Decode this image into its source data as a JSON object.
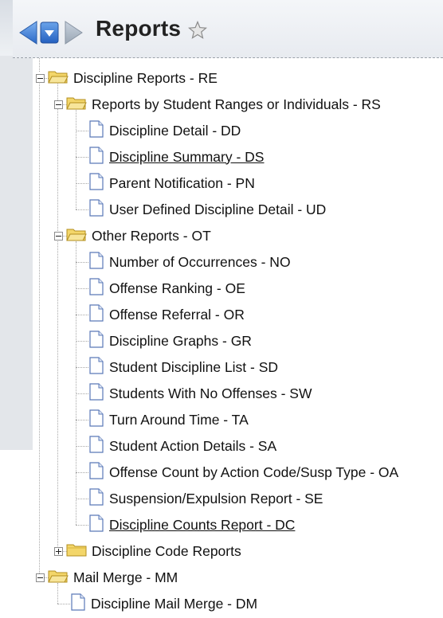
{
  "header": {
    "title": "Reports",
    "icons": [
      "back-arrow-icon",
      "menu-dropdown-icon",
      "forward-arrow-icon",
      "star-icon"
    ]
  },
  "colors": {
    "folder": "#e8c44a",
    "doc_border": "#5a79b8",
    "nav_blue": "#3a7ad6",
    "link": "#111111"
  },
  "tree": [
    {
      "label": "Discipline Reports - RE",
      "type": "folder",
      "expanded": true
    },
    {
      "label": "Reports by Student Ranges or Individuals - RS",
      "type": "folder",
      "expanded": true
    },
    {
      "label": "Discipline Detail - DD",
      "type": "report"
    },
    {
      "label": "Discipline Summary - DS",
      "type": "report",
      "underlined": true
    },
    {
      "label": "Parent Notification - PN",
      "type": "report"
    },
    {
      "label": "User Defined Discipline Detail - UD",
      "type": "report"
    },
    {
      "label": "Other Reports - OT",
      "type": "folder",
      "expanded": true
    },
    {
      "label": "Number of Occurrences - NO",
      "type": "report"
    },
    {
      "label": "Offense Ranking - OE",
      "type": "report"
    },
    {
      "label": "Offense Referral - OR",
      "type": "report"
    },
    {
      "label": "Discipline Graphs - GR",
      "type": "report"
    },
    {
      "label": "Student Discipline List - SD",
      "type": "report"
    },
    {
      "label": "Students With No Offenses - SW",
      "type": "report"
    },
    {
      "label": "Turn Around Time - TA",
      "type": "report"
    },
    {
      "label": "Student Action Details - SA",
      "type": "report"
    },
    {
      "label": "Offense Count by Action Code/Susp Type - OA",
      "type": "report"
    },
    {
      "label": "Suspension/Expulsion Report - SE",
      "type": "report"
    },
    {
      "label": "Discipline Counts Report - DC",
      "type": "report",
      "underlined": true
    },
    {
      "label": "Discipline Code Reports",
      "type": "folder",
      "expanded": false
    },
    {
      "label": "Mail Merge - MM",
      "type": "folder",
      "expanded": true
    },
    {
      "label": "Discipline Mail Merge - DM",
      "type": "report"
    }
  ]
}
